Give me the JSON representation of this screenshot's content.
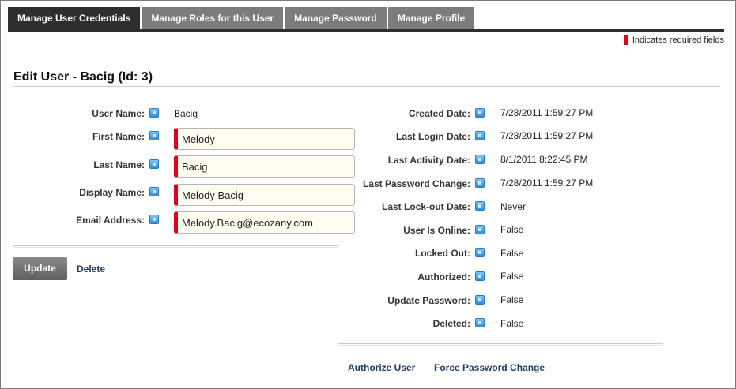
{
  "tabs": [
    {
      "label": "Manage User Credentials",
      "active": true
    },
    {
      "label": "Manage Roles for this User",
      "active": false
    },
    {
      "label": "Manage Password",
      "active": false
    },
    {
      "label": "Manage Profile",
      "active": false
    }
  ],
  "required_note": "Indicates required fields",
  "page_title": "Edit User - Bacig (Id: 3)",
  "left_fields": {
    "user_name": {
      "label": "User Name:",
      "value": "Bacig"
    },
    "first_name": {
      "label": "First Name:",
      "value": "Melody"
    },
    "last_name": {
      "label": "Last Name:",
      "value": "Bacig"
    },
    "display_name": {
      "label": "Display Name:",
      "value": "Melody Bacig"
    },
    "email": {
      "label": "Email Address:",
      "value": "Melody.Bacig@ecozany.com"
    }
  },
  "right_fields": [
    {
      "label": "Created Date:",
      "value": "7/28/2011 1:59:27 PM"
    },
    {
      "label": "Last Login Date:",
      "value": "7/28/2011 1:59:27 PM"
    },
    {
      "label": "Last Activity Date:",
      "value": "8/1/2011 8:22:45 PM"
    },
    {
      "label": "Last Password Change:",
      "value": "7/28/2011 1:59:27 PM"
    },
    {
      "label": "Last Lock-out Date:",
      "value": "Never"
    },
    {
      "label": "User Is Online:",
      "value": "False"
    },
    {
      "label": "Locked Out:",
      "value": "False"
    },
    {
      "label": "Authorized:",
      "value": "False"
    },
    {
      "label": "Update Password:",
      "value": "False"
    },
    {
      "label": "Deleted:",
      "value": "False"
    }
  ],
  "actions": {
    "update": "Update",
    "delete": "Delete",
    "authorize_user": "Authorize User",
    "force_password_change": "Force Password Change"
  },
  "colors": {
    "active_tab": "#2e2e2e",
    "inactive_tab": "#7c7c7c",
    "required_marker": "#e0001b",
    "field_background": "#fffdf1",
    "link": "#1e3a5f"
  }
}
